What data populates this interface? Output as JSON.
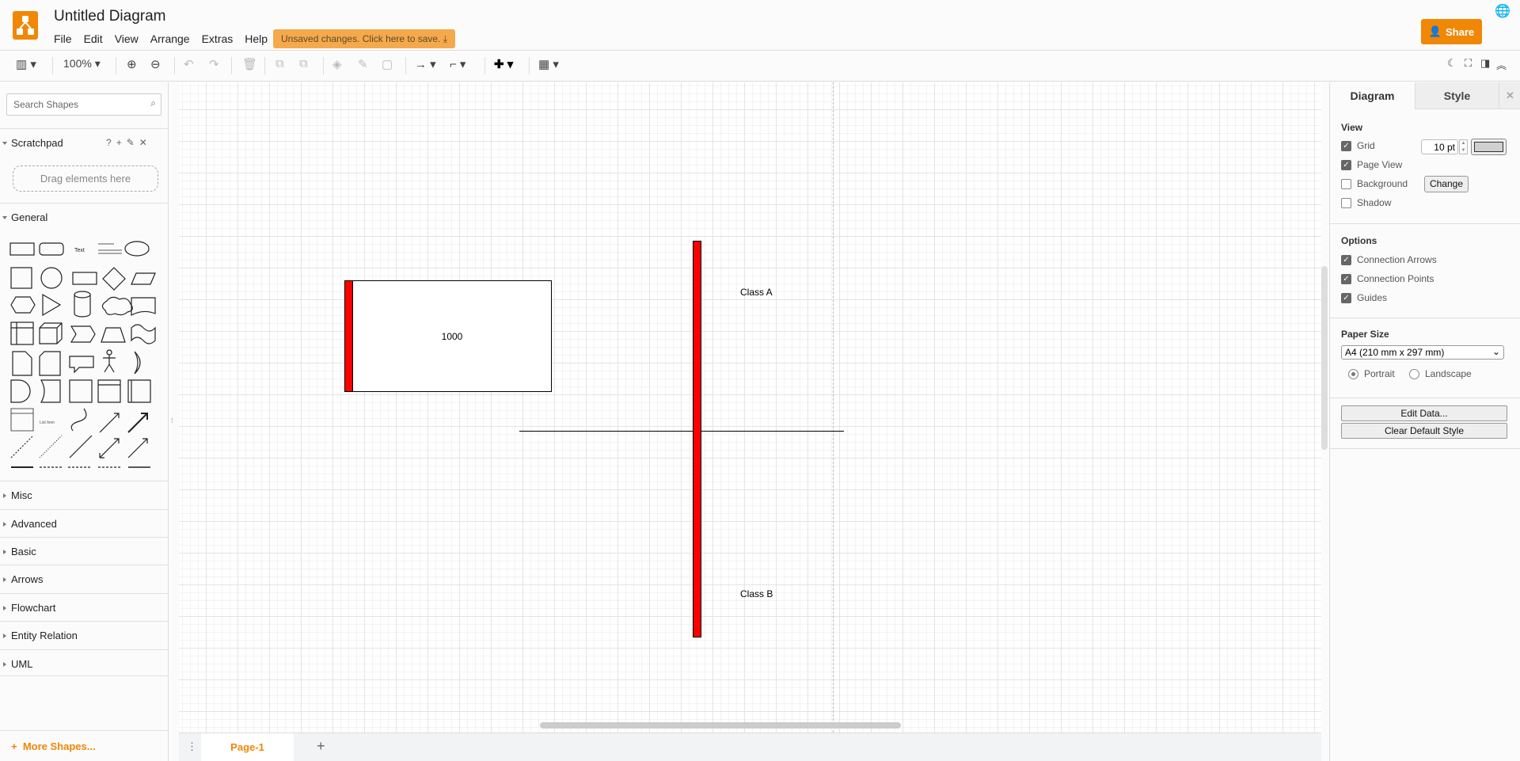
{
  "header": {
    "title": "Untitled Diagram",
    "menus": [
      "File",
      "Edit",
      "View",
      "Arrange",
      "Extras",
      "Help"
    ],
    "unsaved": "Unsaved changes. Click here to save.",
    "share": "Share"
  },
  "toolbar": {
    "zoom": "100%"
  },
  "sidebar": {
    "search_placeholder": "Search Shapes",
    "scratchpad": "Scratchpad",
    "scratchpad_actions": [
      "?",
      "+",
      "✎",
      "✕"
    ],
    "drag_hint": "Drag elements here",
    "general": "General",
    "sections": [
      "Misc",
      "Advanced",
      "Basic",
      "Arrows",
      "Flowchart",
      "Entity Relation",
      "UML"
    ],
    "more_shapes": "More Shapes...",
    "text_shape": "Text",
    "list_item": "List Item"
  },
  "diagram": {
    "box_label": "1000",
    "label_a": "Class A",
    "label_b": "Class B",
    "accent": "#ff0000"
  },
  "panel": {
    "tabs": [
      "Diagram",
      "Style"
    ],
    "view": "View",
    "grid": "Grid",
    "grid_size": "10 pt",
    "page_view": "Page View",
    "background": "Background",
    "change": "Change",
    "shadow": "Shadow",
    "options": "Options",
    "connection_arrows": "Connection Arrows",
    "connection_points": "Connection Points",
    "guides": "Guides",
    "paper_size": "Paper Size",
    "paper_value": "A4 (210 mm x 297 mm)",
    "portrait": "Portrait",
    "landscape": "Landscape",
    "edit_data": "Edit Data...",
    "clear_style": "Clear Default Style"
  },
  "pages": {
    "current": "Page-1"
  },
  "colors": {
    "brand": "#f08705"
  }
}
